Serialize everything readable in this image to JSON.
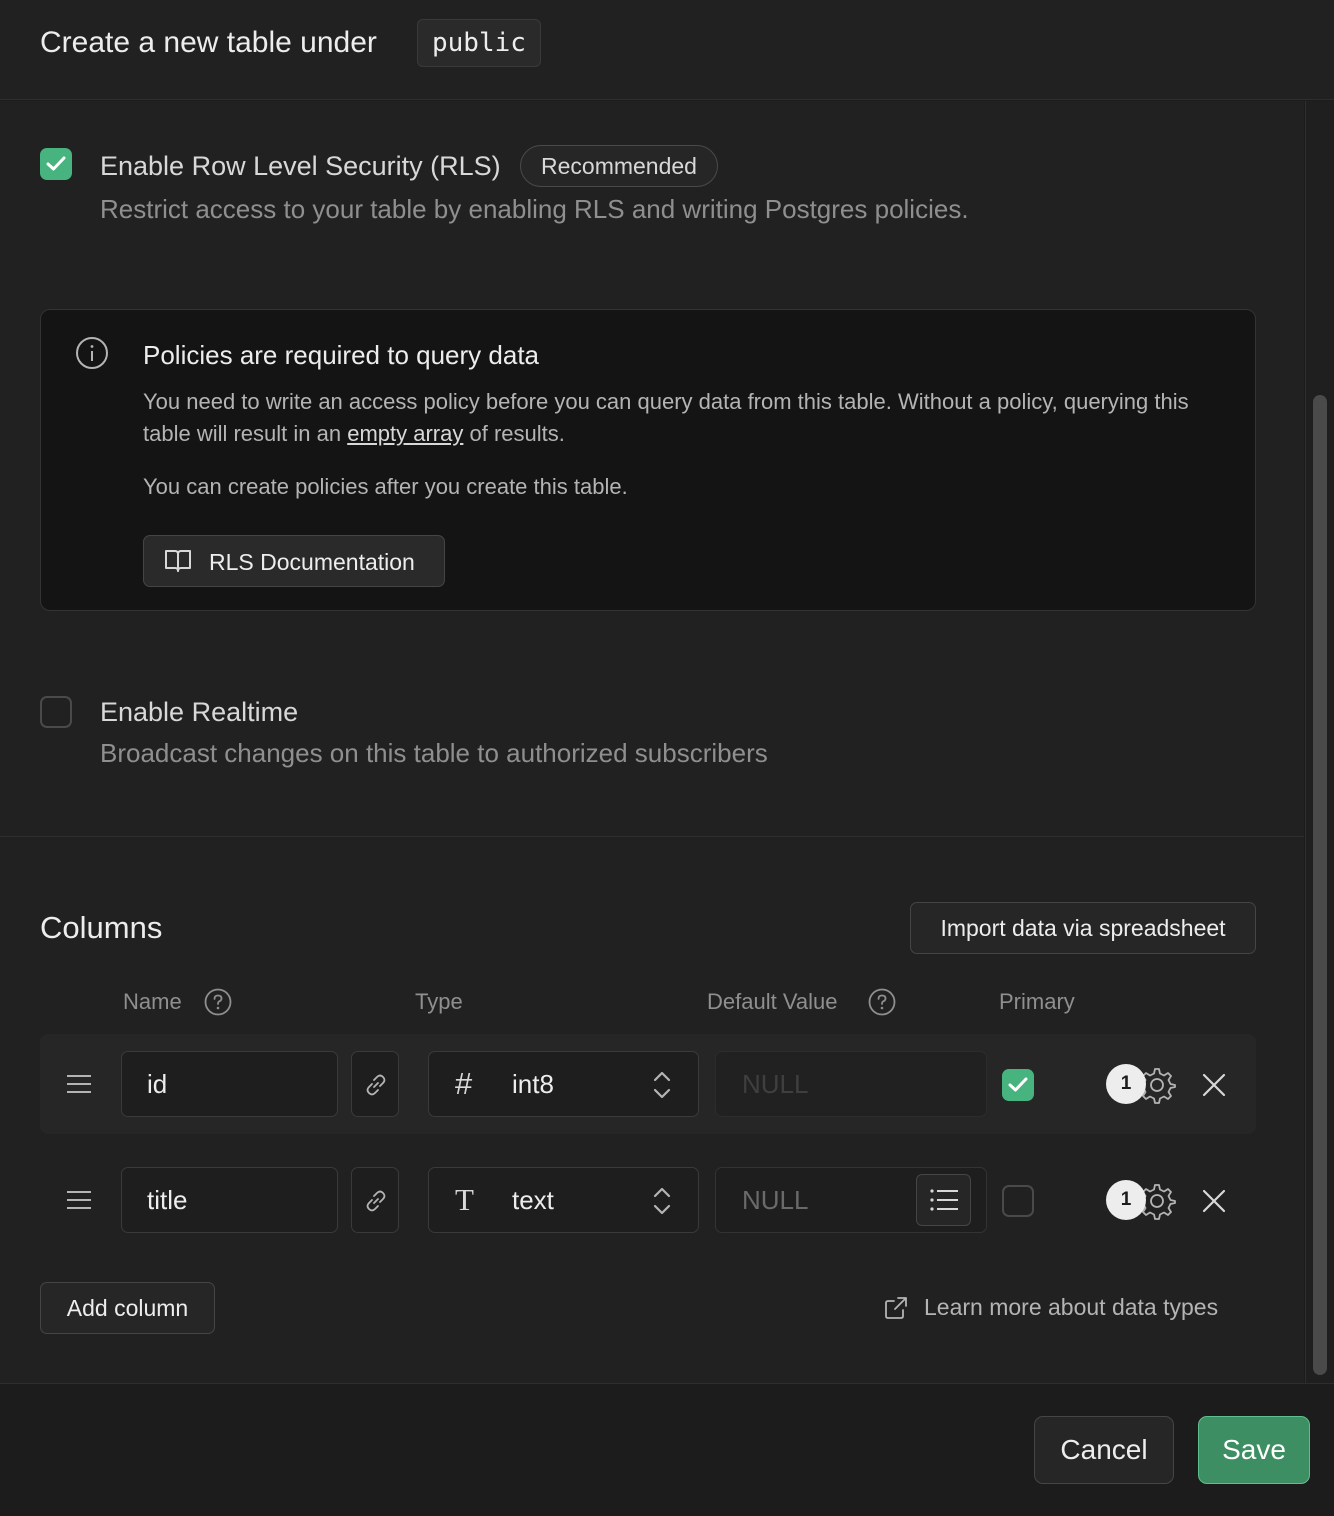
{
  "header": {
    "title": "Create a new table under",
    "schema": "public"
  },
  "rls": {
    "checked": true,
    "label": "Enable Row Level Security (RLS)",
    "badge": "Recommended",
    "description": "Restrict access to your table by enabling RLS and writing Postgres policies."
  },
  "notice": {
    "icon": "info-icon",
    "title": "Policies are required to query data",
    "text_before": "You need to write an access policy before you can query data from this table. Without a policy, querying this table will result in an ",
    "text_link": "empty array",
    "text_after": " of results.",
    "text2": "You can create policies after you create this table.",
    "doc_button": "RLS Documentation"
  },
  "realtime": {
    "checked": false,
    "label": "Enable Realtime",
    "description": "Broadcast changes on this table to authorized subscribers"
  },
  "columns": {
    "title": "Columns",
    "import_button": "Import data via spreadsheet",
    "headers": {
      "name": "Name",
      "type": "Type",
      "default_value": "Default Value",
      "primary": "Primary"
    },
    "rows": [
      {
        "name": "id",
        "type_glyph": "#",
        "type": "int8",
        "default_placeholder": "NULL",
        "primary": true,
        "count": "1"
      },
      {
        "name": "title",
        "type_glyph": "T",
        "type": "text",
        "default_placeholder": "NULL",
        "primary": false,
        "count": "1"
      }
    ],
    "add_button": "Add column",
    "learn_link": "Learn more about data types"
  },
  "footer": {
    "cancel": "Cancel",
    "save": "Save"
  },
  "colors": {
    "accent": "#3e8e63",
    "checkbox_on": "#47b37f",
    "background": "#212121"
  }
}
